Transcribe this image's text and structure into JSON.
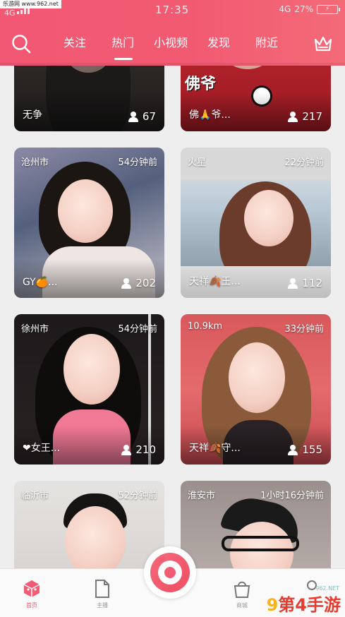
{
  "watermark_top": "乐游网 www.962.net",
  "status": {
    "network": "4G",
    "time": "17:35",
    "net_right": "4G",
    "battery": "27%"
  },
  "nav": {
    "tabs": [
      {
        "label": "关注"
      },
      {
        "label": "热门"
      },
      {
        "label": "小视频"
      },
      {
        "label": "发现"
      },
      {
        "label": "附近"
      }
    ],
    "active_index": 1
  },
  "cards": [
    {
      "location": "",
      "time": "",
      "name": "无争",
      "viewers": "67"
    },
    {
      "location": "",
      "time": "",
      "name": "佛🙏爷...",
      "viewers": "217",
      "banner": "佛爷"
    },
    {
      "location": "沧州市",
      "time": "54分钟前",
      "name": "GY🍊...",
      "viewers": "202"
    },
    {
      "location": "火星",
      "time": "22分钟前",
      "name": "天祥🍂王...",
      "viewers": "112"
    },
    {
      "location": "徐州市",
      "time": "54分钟前",
      "name": "❤女王...",
      "viewers": "210"
    },
    {
      "location": "10.9km",
      "time": "33分钟前",
      "name": "天祥🍂守...",
      "viewers": "155"
    },
    {
      "location": "临沂市",
      "time": "52分钟前",
      "name": "",
      "viewers": ""
    },
    {
      "location": "淮安市",
      "time": "1小时16分钟前",
      "name": "",
      "viewers": ""
    }
  ],
  "bottom_nav": [
    {
      "label": "首页"
    },
    {
      "label": "主播"
    },
    {
      "label": "商城"
    },
    {
      "label": "我的"
    }
  ],
  "watermark_br": {
    "digits": "9",
    "brand": "第4手游",
    "site": "962.NET"
  },
  "colors": {
    "accent": "#f25b73",
    "header": "#f25873"
  }
}
